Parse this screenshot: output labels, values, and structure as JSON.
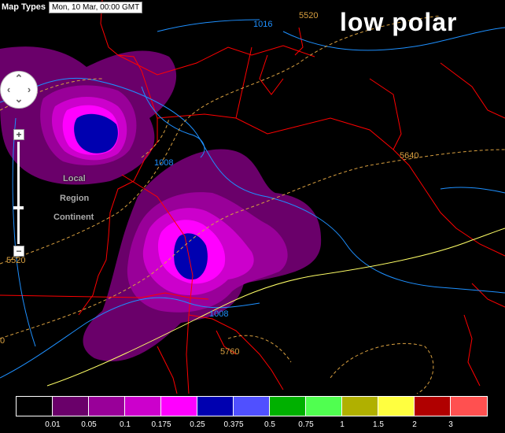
{
  "toolbar": {
    "map_types_label": "Map Types",
    "datetime": "Mon, 10 Mar, 00:00 GMT"
  },
  "title": "low polar",
  "zoom": {
    "plus_label": "+",
    "minus_label": "−",
    "levels": [
      "Local",
      "Region",
      "Continent"
    ]
  },
  "contour_labels": {
    "c1016": "1016",
    "c1008_a": "1008",
    "c1008_b": "1008",
    "c5520_a": "5520",
    "c5520_b": "5520",
    "c5640": "5640",
    "c5760": "5760",
    "c0": "0"
  },
  "colors": {
    "background": "#000000",
    "borders": "#ff0000",
    "pressure_contours": "#1e90ff",
    "height_contours": "#d9a040",
    "freezing_line": "#ffff66"
  },
  "legend": {
    "swatches": [
      "#000000",
      "#6a006a",
      "#990099",
      "#cc00cc",
      "#ff00ff",
      "#0000b0",
      "#5050ff",
      "#00b000",
      "#50ff50",
      "#b0b000",
      "#ffff40",
      "#b00000",
      "#ff5050"
    ],
    "labels": [
      "0.01",
      "0.05",
      "0.1",
      "0.175",
      "0.25",
      "0.375",
      "0.5",
      "0.75",
      "1",
      "1.5",
      "2",
      "3"
    ]
  }
}
